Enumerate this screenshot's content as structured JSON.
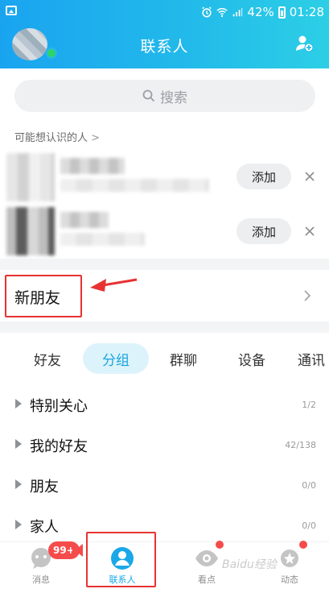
{
  "status_bar": {
    "battery": "42%",
    "time": "01:28"
  },
  "header": {
    "title": "联系人"
  },
  "search": {
    "label": "搜索"
  },
  "may_know": {
    "label": "可能想认识的人",
    "chevron": ">"
  },
  "recommendations": [
    {
      "add_label": "添加"
    },
    {
      "add_label": "添加"
    }
  ],
  "new_friends": {
    "label": "新朋友"
  },
  "tabs": [
    {
      "label": "好友",
      "active": false
    },
    {
      "label": "分组",
      "active": true
    },
    {
      "label": "群聊",
      "active": false
    },
    {
      "label": "设备",
      "active": false
    },
    {
      "label": "通讯",
      "active": false
    }
  ],
  "groups": [
    {
      "name": "特别关心",
      "count": "1/2"
    },
    {
      "name": "我的好友",
      "count": "42/138"
    },
    {
      "name": "朋友",
      "count": "0/0"
    },
    {
      "name": "家人",
      "count": "0/0"
    }
  ],
  "bottom_nav": [
    {
      "label": "消息",
      "icon": "chat-bubble-icon"
    },
    {
      "label": "联系人",
      "icon": "contact-person-icon",
      "active": true
    },
    {
      "label": "看点",
      "icon": "eye-icon"
    },
    {
      "label": "动态",
      "icon": "star-planet-icon"
    }
  ],
  "badges": {
    "messages": "99+"
  },
  "colors": {
    "header_start": "#1aa4f0",
    "header_end": "#2ccfe6",
    "accent": "#18a4df",
    "annotation_red": "#e83232"
  },
  "watermark": "Baidu经验"
}
